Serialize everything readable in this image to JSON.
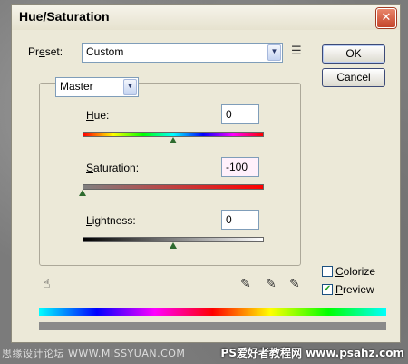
{
  "window": {
    "title": "Hue/Saturation",
    "close_glyph": "✕"
  },
  "preset": {
    "label": "Preset:",
    "value": "Custom"
  },
  "buttons": {
    "ok": "OK",
    "cancel": "Cancel"
  },
  "edit": {
    "value": "Master"
  },
  "hue": {
    "label": "Hue:",
    "value": "0",
    "level": 0.5
  },
  "saturation": {
    "label": "Saturation:",
    "value": "-100",
    "level": 0.0
  },
  "lightness": {
    "label": "Lightness:",
    "value": "0",
    "level": 0.5
  },
  "options": {
    "colorize": {
      "label": "Colorize",
      "checked": false
    },
    "preview": {
      "label": "Preview",
      "checked": true
    }
  },
  "icons": [
    "preset-options-icon",
    "hand-tool-icon",
    "eyedropper-icon",
    "eyedropper-plus-icon",
    "eyedropper-minus-icon"
  ],
  "watermark": {
    "left": "思缘设计论坛 WWW.MISSYUAN.COM",
    "right": "PS爱好者教程网 www.psahz.com"
  }
}
